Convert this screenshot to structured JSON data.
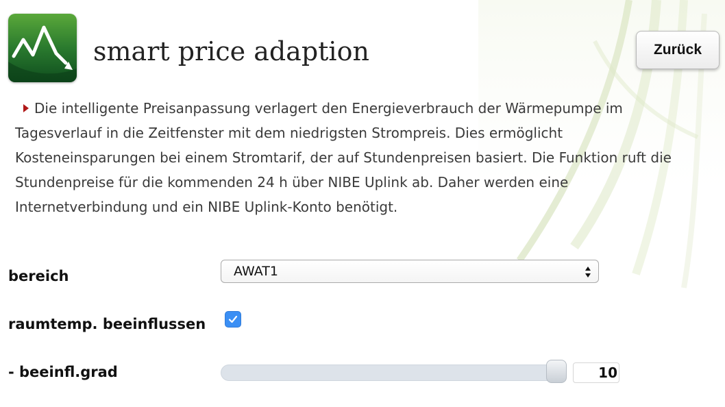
{
  "app": {
    "title": "smart price adaption",
    "icon": "price-graph-icon"
  },
  "header": {
    "back_label": "Zurück"
  },
  "description": {
    "text": "Die intelligente Preisanpassung verlagert den Energieverbrauch der Wärmepumpe im Tagesverlauf in die Zeitfenster mit dem niedrigsten Strompreis. Dies ermöglicht Kosteneinsparungen bei einem Stromtarif, der auf Stundenpreisen basiert. Die Funktion ruft die Stundenpreise für die kommenden 24 h über NIBE Uplink ab. Daher werden eine Internetverbindung und ein NIBE Uplink-Konto benötigt."
  },
  "form": {
    "bereich": {
      "label": "bereich",
      "value": "AWAT1"
    },
    "raumtemp": {
      "label": "raumtemp. beeinflussen",
      "checked": true
    },
    "beeinfl_grad": {
      "label": "- beeinfl.grad",
      "value": "10",
      "min": 1,
      "max": 10
    }
  },
  "colors": {
    "accent": "#3b8ff4",
    "bullet": "#b01818",
    "icon_green": "#1e6b2e"
  }
}
